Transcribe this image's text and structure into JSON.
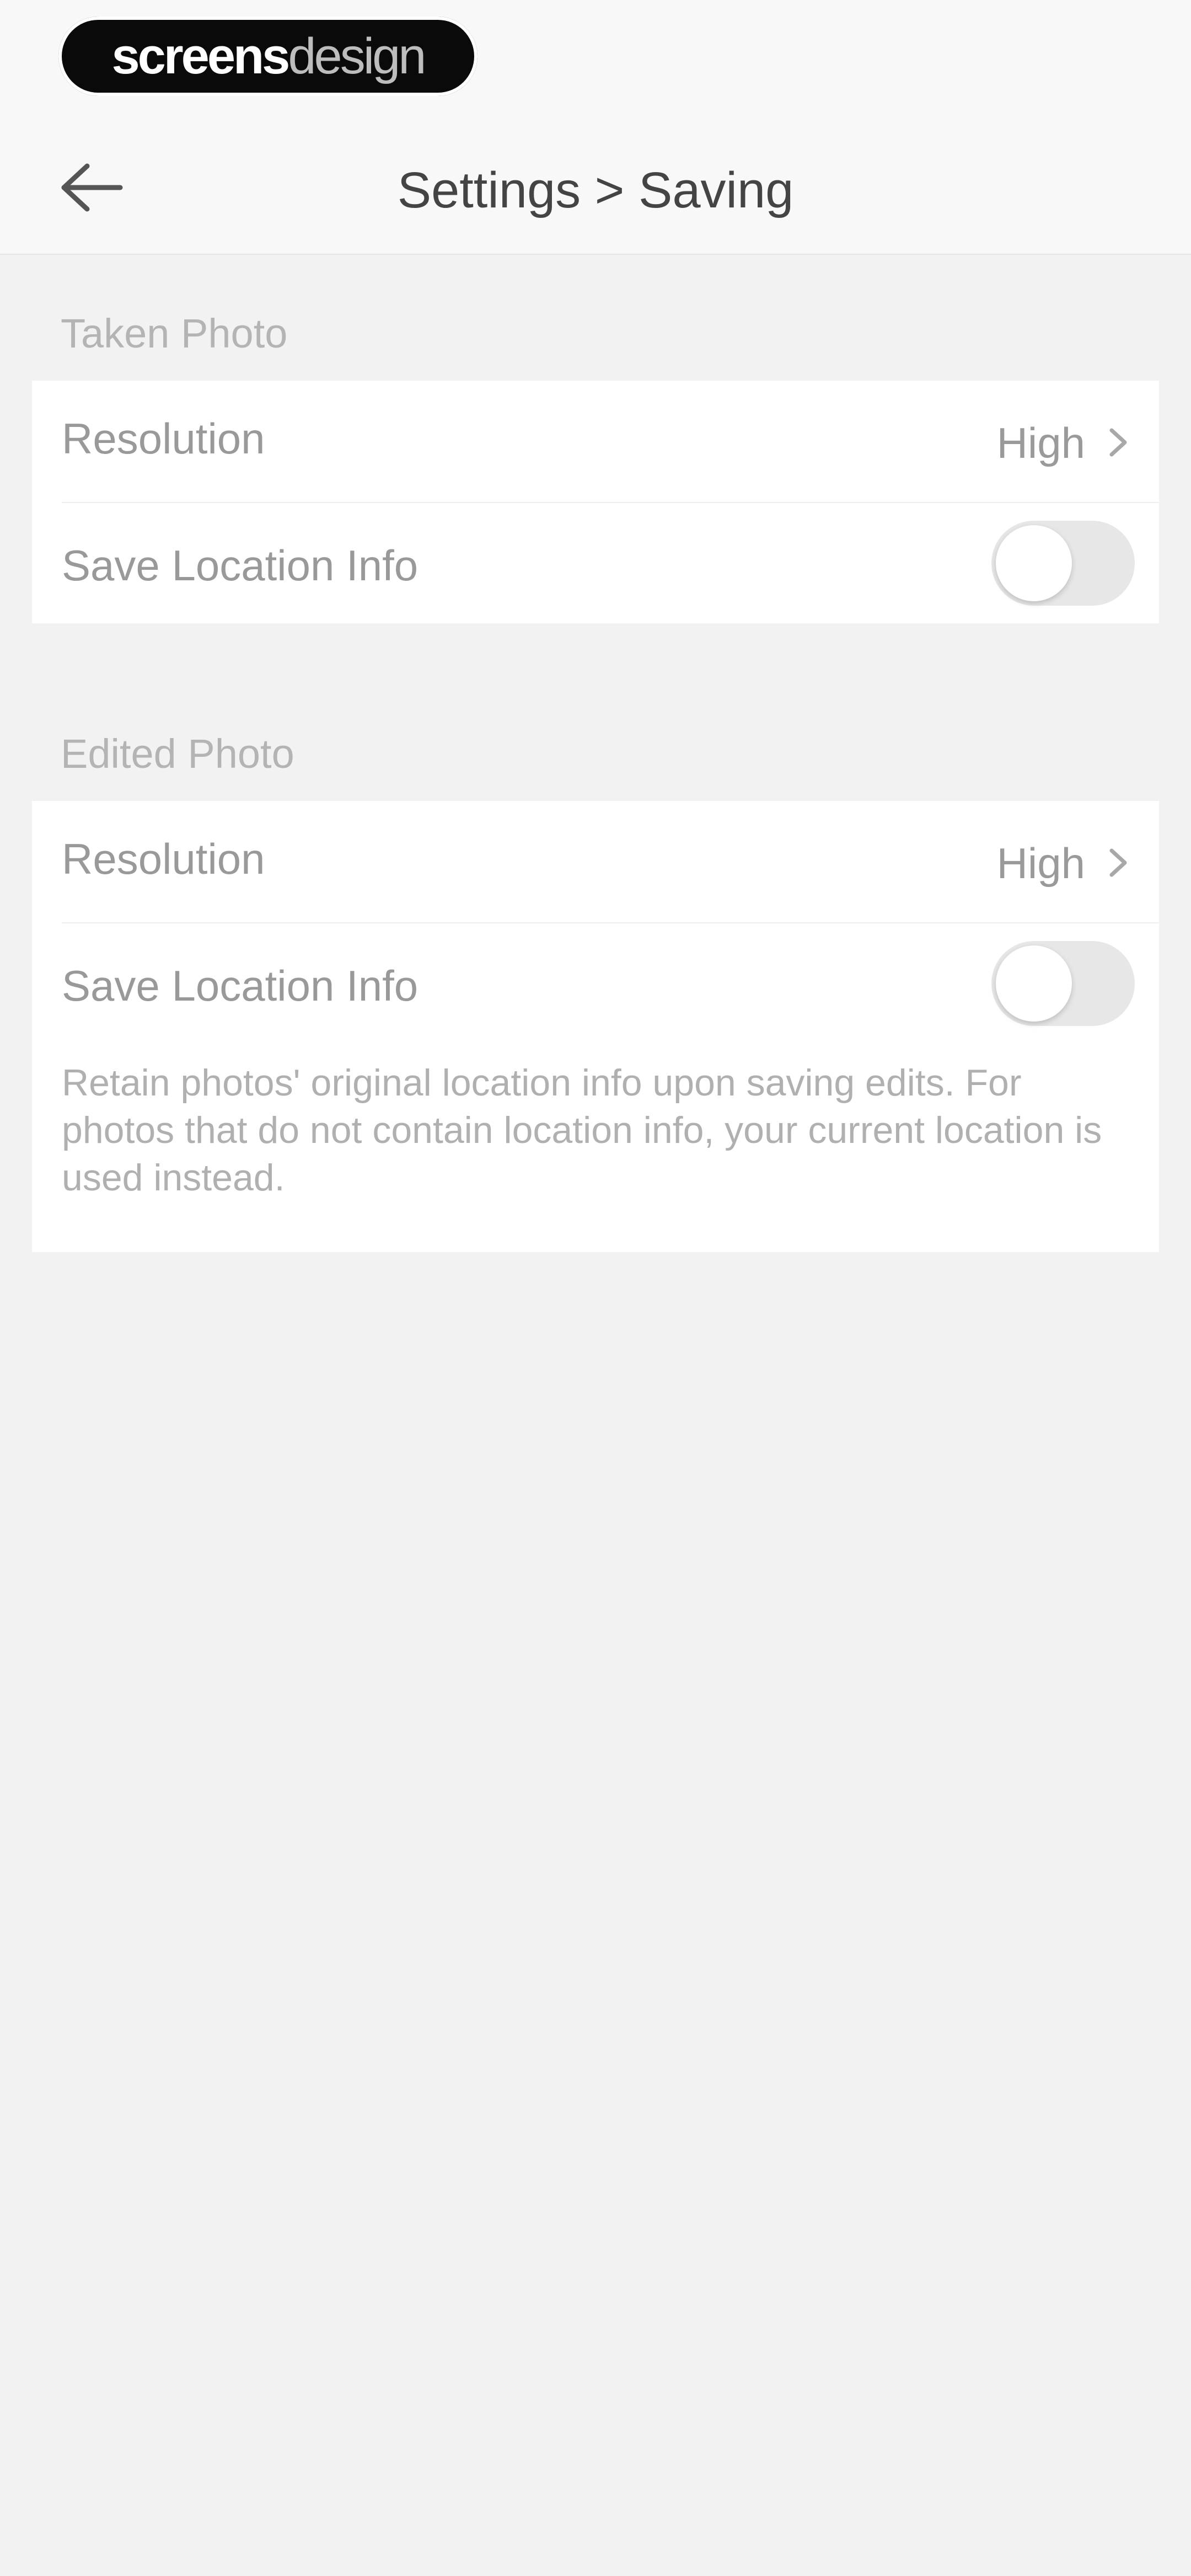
{
  "branding": {
    "watermark_strong": "screens",
    "watermark_light": "design"
  },
  "header": {
    "title": "Settings > Saving",
    "back_icon": "arrow-left-icon"
  },
  "sections": [
    {
      "label": "Taken Photo",
      "rows": [
        {
          "label": "Resolution",
          "value": "High",
          "icon": "chevron-right-icon"
        },
        {
          "label": "Save Location Info",
          "toggle": false
        }
      ]
    },
    {
      "label": "Edited Photo",
      "rows": [
        {
          "label": "Resolution",
          "value": "High",
          "icon": "chevron-right-icon"
        },
        {
          "label": "Save Location Info",
          "toggle": false,
          "description": "Retain photos' original location info upon saving edits. For photos that do not contain location info, your current location is used instead."
        }
      ]
    }
  ],
  "colors": {
    "background": "#f2f2f2",
    "card": "#ffffff",
    "toggle_off": "#e7e7e7",
    "text_muted": "#999999"
  }
}
